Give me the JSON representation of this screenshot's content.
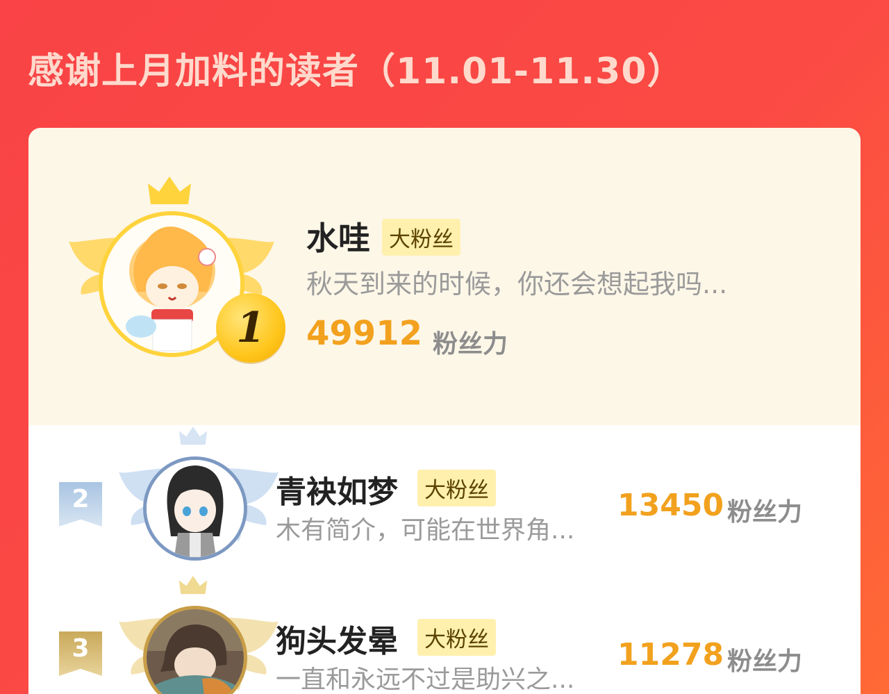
{
  "header": {
    "title": "感谢上月加料的读者（11.01-11.30）"
  },
  "top_reader": {
    "rank": "1",
    "name": "水哇",
    "badge": "大粉丝",
    "bio": "秋天到来的时候，你还会想起我吗...",
    "score": "49912",
    "unit": "粉丝力",
    "avatar": "anime-avatar-orange-hair"
  },
  "readers": [
    {
      "rank": "2",
      "name": "青袂如梦",
      "badge": "大粉丝",
      "bio": "木有简介，可能在世界角...",
      "score": "13450",
      "unit": "粉丝力",
      "avatar": "anime-avatar-dark-hair"
    },
    {
      "rank": "3",
      "name": "狗头发晕",
      "badge": "大粉丝",
      "bio": "一直和永远不过是助兴之...",
      "score": "11278",
      "unit": "粉丝力",
      "avatar": "anime-avatar-brown-hair"
    }
  ],
  "colors": {
    "background": "#f94346",
    "score": "#f2a11e",
    "badge_bg": "#fff0ae",
    "gold": "#ffd33c",
    "silver": "#7d99c2",
    "bronze": "#c79d46"
  }
}
